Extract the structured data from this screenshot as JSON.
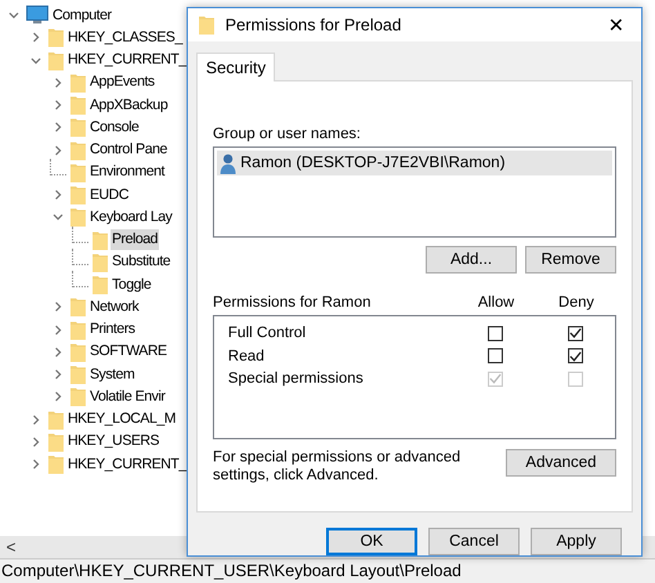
{
  "tree": [
    {
      "label": "Computer",
      "kind": "computer",
      "expanded": true,
      "selected": false,
      "children": [
        {
          "label": "HKEY_CLASSES_",
          "kind": "folder",
          "expanded": false,
          "selected": false,
          "has_children": true
        },
        {
          "label": "HKEY_CURRENT_",
          "kind": "folder",
          "expanded": true,
          "selected": false,
          "has_children": true,
          "children": [
            {
              "label": "AppEvents",
              "kind": "folder",
              "expanded": false,
              "selected": false,
              "has_children": true
            },
            {
              "label": "AppXBackup",
              "kind": "folder",
              "expanded": false,
              "selected": false,
              "has_children": true
            },
            {
              "label": "Console",
              "kind": "folder",
              "expanded": false,
              "selected": false,
              "has_children": true
            },
            {
              "label": "Control Pane",
              "kind": "folder",
              "expanded": false,
              "selected": false,
              "has_children": true
            },
            {
              "label": "Environment",
              "kind": "folder",
              "expanded": false,
              "selected": false,
              "has_children": false
            },
            {
              "label": "EUDC",
              "kind": "folder",
              "expanded": false,
              "selected": false,
              "has_children": true
            },
            {
              "label": "Keyboard Lay",
              "kind": "folder",
              "expanded": true,
              "selected": false,
              "has_children": true,
              "children": [
                {
                  "label": "Preload",
                  "kind": "folder",
                  "expanded": false,
                  "selected": true,
                  "has_children": false
                },
                {
                  "label": "Substitute",
                  "kind": "folder",
                  "expanded": false,
                  "selected": false,
                  "has_children": false
                },
                {
                  "label": "Toggle",
                  "kind": "folder",
                  "expanded": false,
                  "selected": false,
                  "has_children": false
                }
              ]
            },
            {
              "label": "Network",
              "kind": "folder",
              "expanded": false,
              "selected": false,
              "has_children": true
            },
            {
              "label": "Printers",
              "kind": "folder",
              "expanded": false,
              "selected": false,
              "has_children": true
            },
            {
              "label": "SOFTWARE",
              "kind": "folder",
              "expanded": false,
              "selected": false,
              "has_children": true
            },
            {
              "label": "System",
              "kind": "folder",
              "expanded": false,
              "selected": false,
              "has_children": true
            },
            {
              "label": "Volatile Envir",
              "kind": "folder",
              "expanded": false,
              "selected": false,
              "has_children": true
            }
          ]
        },
        {
          "label": "HKEY_LOCAL_M",
          "kind": "folder",
          "expanded": false,
          "selected": false,
          "has_children": true
        },
        {
          "label": "HKEY_USERS",
          "kind": "folder",
          "expanded": false,
          "selected": false,
          "has_children": true
        },
        {
          "label": "HKEY_CURRENT_",
          "kind": "folder",
          "expanded": false,
          "selected": false,
          "has_children": true
        }
      ]
    }
  ],
  "scroll_left": "<",
  "status_bar": "Computer\\HKEY_CURRENT_USER\\Keyboard Layout\\Preload",
  "dialog": {
    "title": "Permissions for Preload",
    "close": "✕",
    "tabs": [
      {
        "label": "Security",
        "selected": true
      }
    ],
    "group_label": "Group or user names:",
    "users": [
      {
        "name": "Ramon (DESKTOP-J7E2VBI\\Ramon)",
        "selected": true
      }
    ],
    "user_buttons": [
      "Add...",
      "Remove"
    ],
    "permissions_label": "Permissions for Ramon",
    "allow_label": "Allow",
    "deny_label": "Deny",
    "permissions": [
      {
        "name": "Full Control",
        "allow": {
          "checked": false,
          "disabled": false
        },
        "deny": {
          "checked": true,
          "disabled": false
        }
      },
      {
        "name": "Read",
        "allow": {
          "checked": false,
          "disabled": false
        },
        "deny": {
          "checked": true,
          "disabled": false
        }
      },
      {
        "name": "Special permissions",
        "allow": {
          "checked": true,
          "disabled": true
        },
        "deny": {
          "checked": false,
          "disabled": true
        }
      }
    ],
    "advanced_note": "For special permissions or advanced settings, click Advanced.",
    "advanced_button": "Advanced",
    "buttons": [
      {
        "label": "OK",
        "default": true
      },
      {
        "label": "Cancel",
        "default": false
      },
      {
        "label": "Apply",
        "default": false
      }
    ]
  }
}
